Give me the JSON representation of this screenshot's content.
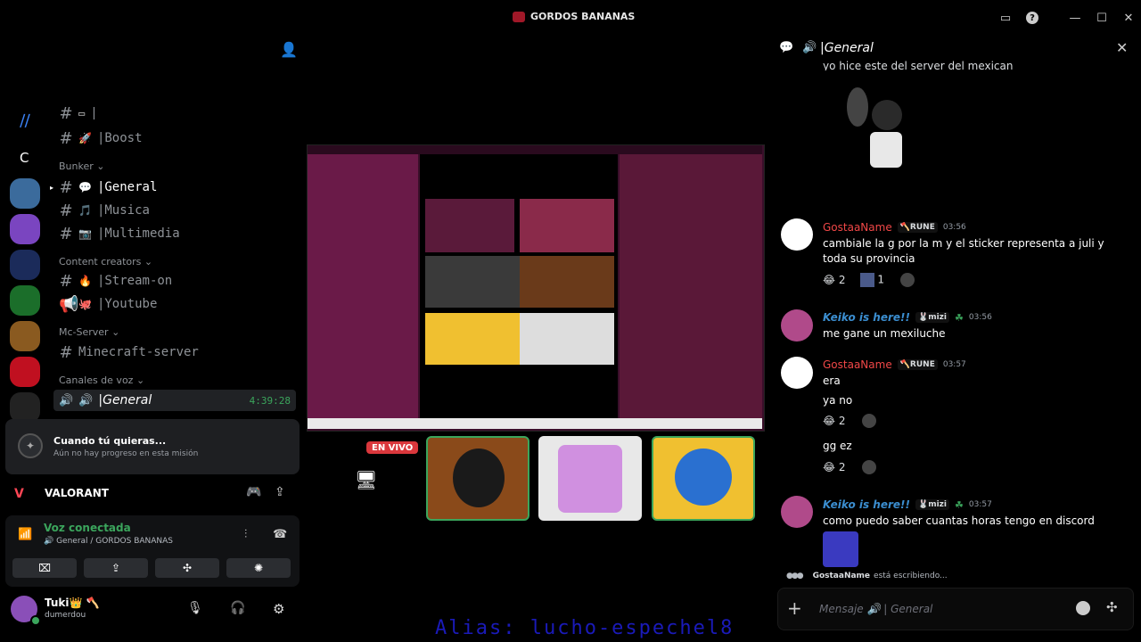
{
  "titlebar": {
    "server_name": "GORDOS BANANAS",
    "buttons": [
      "inbox-icon",
      "help-icon",
      "minimize-icon",
      "maximize-icon",
      "close-icon"
    ]
  },
  "channels": {
    "partial_item": "|",
    "boost": {
      "emoji": "🚀",
      "label": "|Boost"
    },
    "categories": {
      "bunker": "Bunker ⌄",
      "content": "Content creators ⌄",
      "mc": "Mc-Server ⌄",
      "voice": "Canales de voz ⌄"
    },
    "general": {
      "emoji": "💬",
      "label": "|General"
    },
    "musica": {
      "emoji": "🎵",
      "label": "|Musica"
    },
    "multimedia": {
      "emoji": "📷",
      "label": "|Multimedia"
    },
    "stream": {
      "emoji": "🔥",
      "label": "|Stream-on"
    },
    "youtube": {
      "emoji": "🐙",
      "label": "|Youtube"
    },
    "minecraft": {
      "label": "Minecraft-server"
    },
    "voice_general": {
      "label": "|General",
      "time": "4:39:28"
    },
    "rail_letter": "C"
  },
  "quest": {
    "title": "Cuando tú quieras...",
    "subtitle": "Aún no hay progreso en esta misión"
  },
  "game": {
    "name": "VALORANT"
  },
  "voice": {
    "status": "Voz conectada",
    "channel": "🔊 General / GORDOS BANANAS"
  },
  "user": {
    "name": "Tuki👑 🪓",
    "tag": "dumerdou"
  },
  "stage": {
    "live_badge": "EN VIVO",
    "alias_text": "Alias: lucho-espechel8"
  },
  "chat": {
    "header_channel": "|General",
    "partial_msg": "yo hice este del server del mexican",
    "messages": [
      {
        "author": "GostaaName",
        "badge": "🪓RUNE",
        "time": "03:56",
        "text": "cambiale la g por la m y el sticker representa a juli y toda su provincia",
        "color": "#f04747"
      },
      {
        "author": "Keiko is here!!",
        "badge": "🐰mizi",
        "time": "03:56",
        "text": "me gane un mexiluche",
        "color": "#3b8ed0"
      },
      {
        "author": "GostaaName",
        "badge": "🪓RUNE",
        "time": "03:57",
        "text": "era",
        "color": "#f04747"
      },
      {
        "text": "ya no"
      },
      {
        "text": "gg ez"
      },
      {
        "author": "Keiko is here!!",
        "badge": "🐰mizi",
        "time": "03:57",
        "text": "como puedo saber cuantas horas tengo en discord",
        "color": "#3b8ed0"
      }
    ],
    "reactions": {
      "r1": {
        "emoji": "😂",
        "count": "2"
      },
      "r2": {
        "count": "1"
      },
      "r3": {
        "emoji": "😂",
        "count": "2"
      },
      "r4": {
        "emoji": "😂",
        "count": "2"
      }
    },
    "typing": {
      "who": "GostaaName",
      "rest": " está escribiendo..."
    },
    "input_placeholder": "Mensaje 🔊 | General"
  }
}
